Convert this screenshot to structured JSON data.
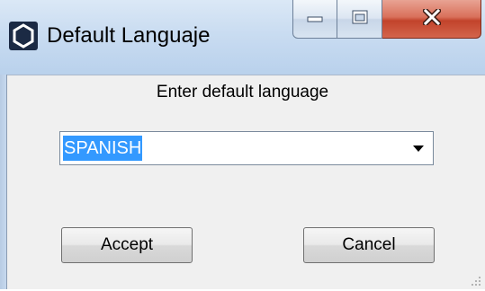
{
  "window": {
    "title": "Default Languaje",
    "icon": "app-hexagon-icon",
    "caption_buttons": [
      "minimize-icon",
      "maximize-icon",
      "close-icon"
    ]
  },
  "dialog": {
    "prompt": "Enter default language",
    "language_select": {
      "value": "SPANISH",
      "selected": true
    },
    "accept_label": "Accept",
    "cancel_label": "Cancel"
  },
  "colors": {
    "selection": "#3399ff",
    "titlebar": "#c9dcf1",
    "close_button": "#c2432b",
    "background": "#f0f0f0"
  }
}
